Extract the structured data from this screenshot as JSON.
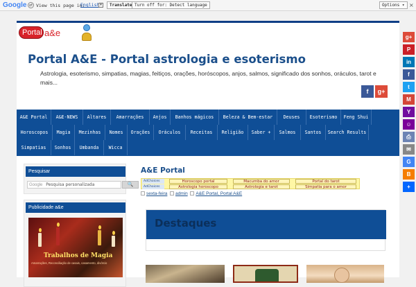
{
  "translate_bar": {
    "google_logo": "Google",
    "prompt": "View this page in:",
    "language": "English",
    "translate_button": "Translate",
    "turn_off_button": "Turn off for: Detect language",
    "options_button": "Options ▾",
    "close": "×"
  },
  "site": {
    "logo_text_left": "Portal",
    "logo_text_right": "a&e",
    "title": "Portal A&E - Portal astrologia e esoterismo",
    "description": "Astrologia, esoterismo, simpatias, magias, feitiços, orações, horóscopos, anjos, salmos, significado dos sonhos, oráculos, tarot e mais..."
  },
  "header_social": [
    {
      "name": "facebook",
      "glyph": "f",
      "color": "#3b5998"
    },
    {
      "name": "google-plus",
      "glyph": "g+",
      "color": "#dd4b39"
    }
  ],
  "nav": {
    "rows": [
      [
        "A&E Portal",
        "A&E-NEWS",
        "Altares",
        "Amarrações",
        "Anjos",
        "Banhos mágicos",
        "Beleza & Bem-estar",
        "Deuses",
        "Esoterismo",
        "Feng Shui"
      ],
      [
        "Horoscopos",
        "Magia",
        "Mezinhas",
        "Nomes",
        "Orações",
        "Oráculos",
        "Receitas",
        "Religião",
        "Saber +",
        "Salmos",
        "Santos",
        "Search Results"
      ],
      [
        "Simpatias",
        "Sonhos",
        "Umbanda",
        "Wicca"
      ]
    ]
  },
  "sidebar": {
    "search_title": "Pesquisar",
    "search_prefix": "Google",
    "search_placeholder": "Pesquisa personalizada",
    "search_button": "🔍",
    "ad_title": "Publicidade a&e",
    "ad_heading": "Trabalhos de Magia",
    "ad_subtext": "Amarrações, Reconciliação de casais, casamento, divórcio"
  },
  "post": {
    "title": "A&E Portal",
    "adchoices_label": "AdChoices",
    "ad_links": [
      "Horoscopo portal",
      "Macumba do amor",
      "Portal do tarot",
      "Astrologia horoscopo",
      "Astrologia e tarot",
      "Simpatia para o amor"
    ],
    "date": "sexta-feira",
    "author": "admin",
    "categories": "A&E Portal, Portal A&E",
    "destaques": "Destaques"
  },
  "share_bar": [
    {
      "name": "google-plus",
      "glyph": "g+",
      "color": "#dd4b39"
    },
    {
      "name": "pinterest",
      "glyph": "P",
      "color": "#cb2027"
    },
    {
      "name": "linkedin",
      "glyph": "in",
      "color": "#0077b5"
    },
    {
      "name": "facebook",
      "glyph": "f",
      "color": "#3b5998"
    },
    {
      "name": "twitter",
      "glyph": "t",
      "color": "#1da1f2"
    },
    {
      "name": "gmail",
      "glyph": "M",
      "color": "#d44638"
    },
    {
      "name": "yahoo-mail",
      "glyph": "Y",
      "color": "#720e9e"
    },
    {
      "name": "yahoo-messenger",
      "glyph": "☺",
      "color": "#7b0099"
    },
    {
      "name": "print",
      "glyph": "⎙",
      "color": "#6d84b4"
    },
    {
      "name": "email",
      "glyph": "✉",
      "color": "#888888"
    },
    {
      "name": "google-bookmarks",
      "glyph": "G",
      "color": "#4285f4"
    },
    {
      "name": "blogger",
      "glyph": "B",
      "color": "#f57d00"
    },
    {
      "name": "more-share",
      "glyph": "+",
      "color": "#0166ff"
    }
  ],
  "colors": {
    "brand_blue": "#0f4e96",
    "title_blue": "#1b4f8b",
    "logo_red": "#d8232a"
  }
}
